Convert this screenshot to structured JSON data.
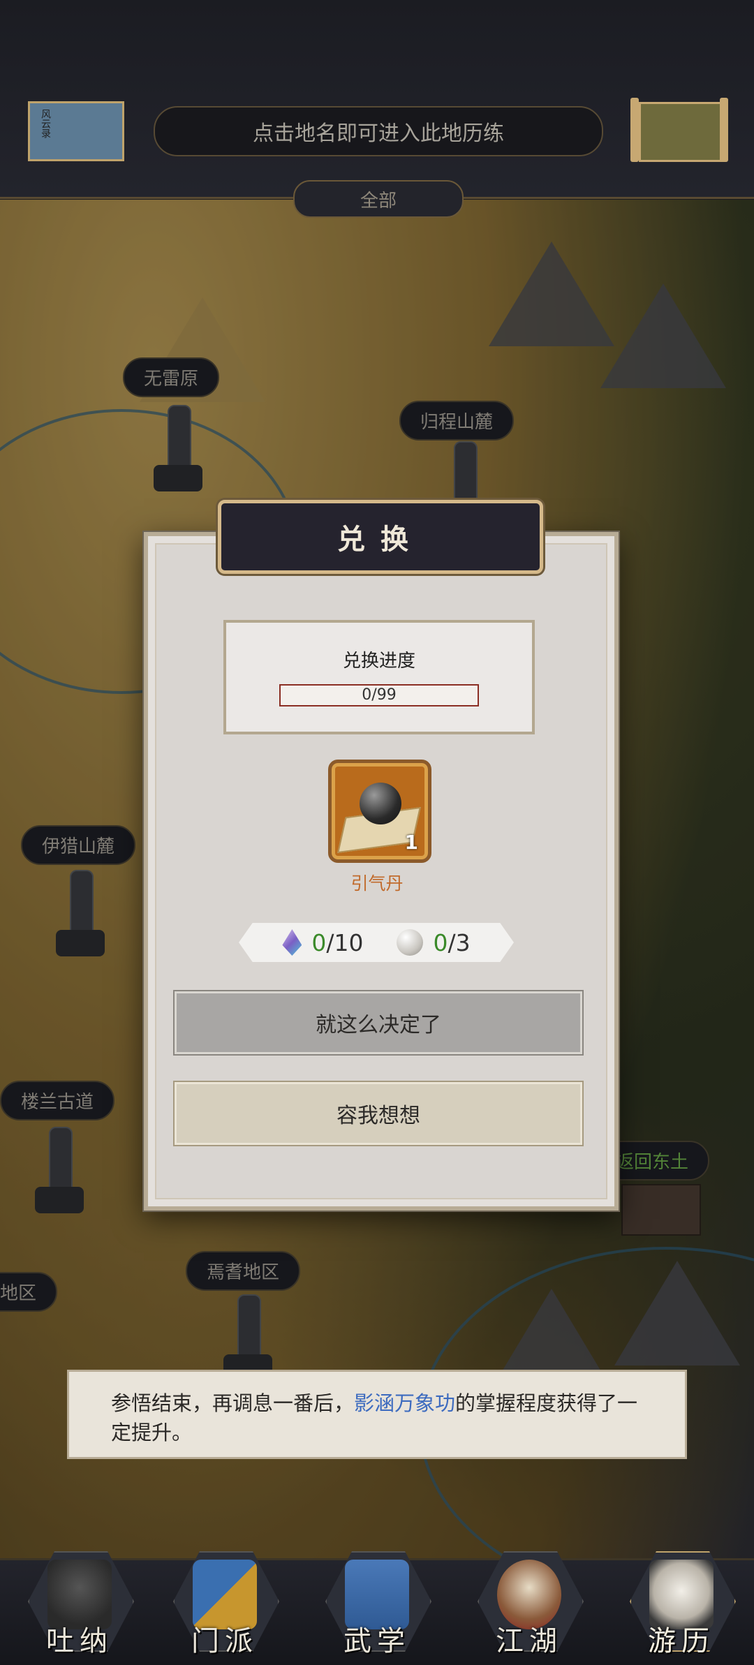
{
  "header": {
    "left_thumbnail_text": "风云录",
    "banner_text": "点击地名即可进入此地历练",
    "filter_tab": "全部"
  },
  "map": {
    "regions": [
      {
        "label": "无雷原"
      },
      {
        "label": "归程山麓"
      },
      {
        "label": "伊猎山麓"
      },
      {
        "label": "楼兰古道"
      },
      {
        "label": "焉耆地区"
      },
      {
        "label": "地区"
      },
      {
        "label": "返回东土"
      }
    ]
  },
  "dialog": {
    "title": "兑换",
    "progress": {
      "label": "兑换进度",
      "text": "0/99",
      "current": 0,
      "max": 99
    },
    "item": {
      "name": "引气丹",
      "count": "1",
      "icon": "black-pill-on-cloth-icon"
    },
    "cost": {
      "gem": {
        "have": "0",
        "need": "/10",
        "icon": "crystal-gem-icon"
      },
      "pearl": {
        "have": "0",
        "need": "/3",
        "icon": "pearl-icon"
      }
    },
    "confirm_label": "就这么决定了",
    "cancel_label": "容我想想"
  },
  "message": {
    "prefix": "参悟结束，再调息一番后，",
    "highlight": "影涵万象功",
    "suffix": "的掌握程度获得了一定提升。"
  },
  "nav": {
    "items": [
      {
        "label": "吐纳",
        "icon": "meditating-figure-icon"
      },
      {
        "label": "门派",
        "icon": "sect-banner-icon"
      },
      {
        "label": "武学",
        "icon": "martial-books-icon"
      },
      {
        "label": "江湖",
        "icon": "bamboo-hat-icon"
      },
      {
        "label": "游历",
        "icon": "white-horse-icon",
        "active": true
      }
    ]
  },
  "colors": {
    "accent_gold": "#d5b98a",
    "item_name": "#c16a2b",
    "cost_have": "#3b8a2a",
    "highlight_blue": "#3d6bbf",
    "region_green": "#6fb04a"
  }
}
